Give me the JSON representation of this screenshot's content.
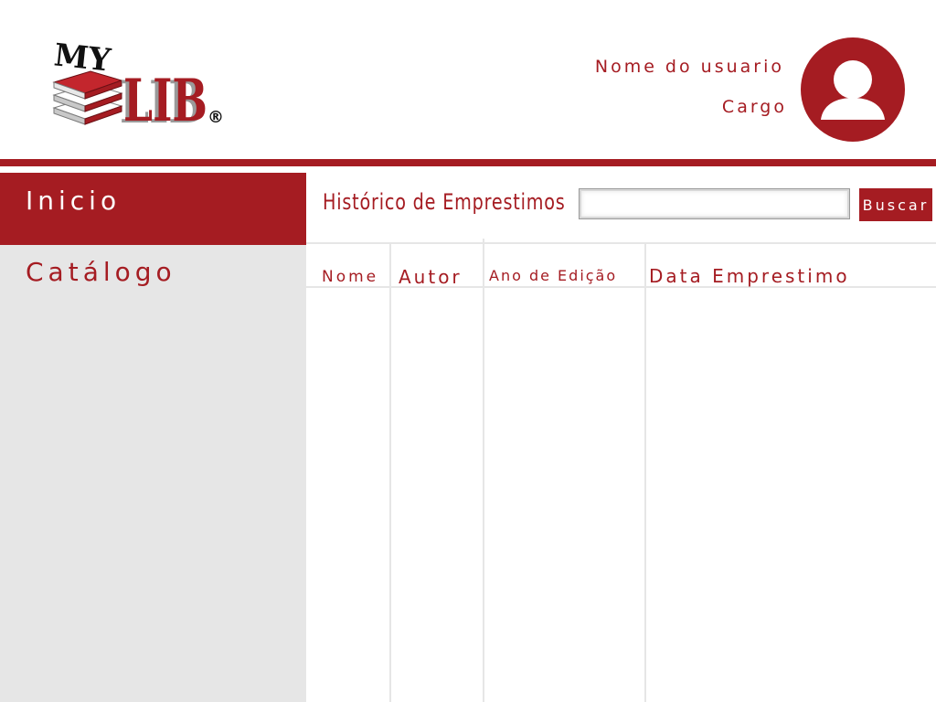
{
  "brand": {
    "logo_top_text": "MY",
    "logo_main_text": "LIB",
    "logo_mark": "®"
  },
  "user": {
    "name": "Nome do usuario",
    "role": "Cargo",
    "avatar_icon": "user-avatar-icon"
  },
  "sidebar": {
    "items": [
      {
        "label": "Inicio",
        "active": true
      },
      {
        "label": "Catálogo",
        "active": false
      }
    ]
  },
  "main": {
    "title": "Histórico de Emprestimos",
    "search": {
      "value": "",
      "placeholder": "",
      "button_label": "Buscar"
    },
    "table": {
      "columns": [
        "Nome",
        "Autor",
        "Ano de Edição",
        "Data Emprestimo"
      ],
      "rows": []
    }
  },
  "colors": {
    "accent": "#a51c22",
    "sidebar_bg": "#e6e6e6",
    "grid_line": "#e6e6e6"
  }
}
